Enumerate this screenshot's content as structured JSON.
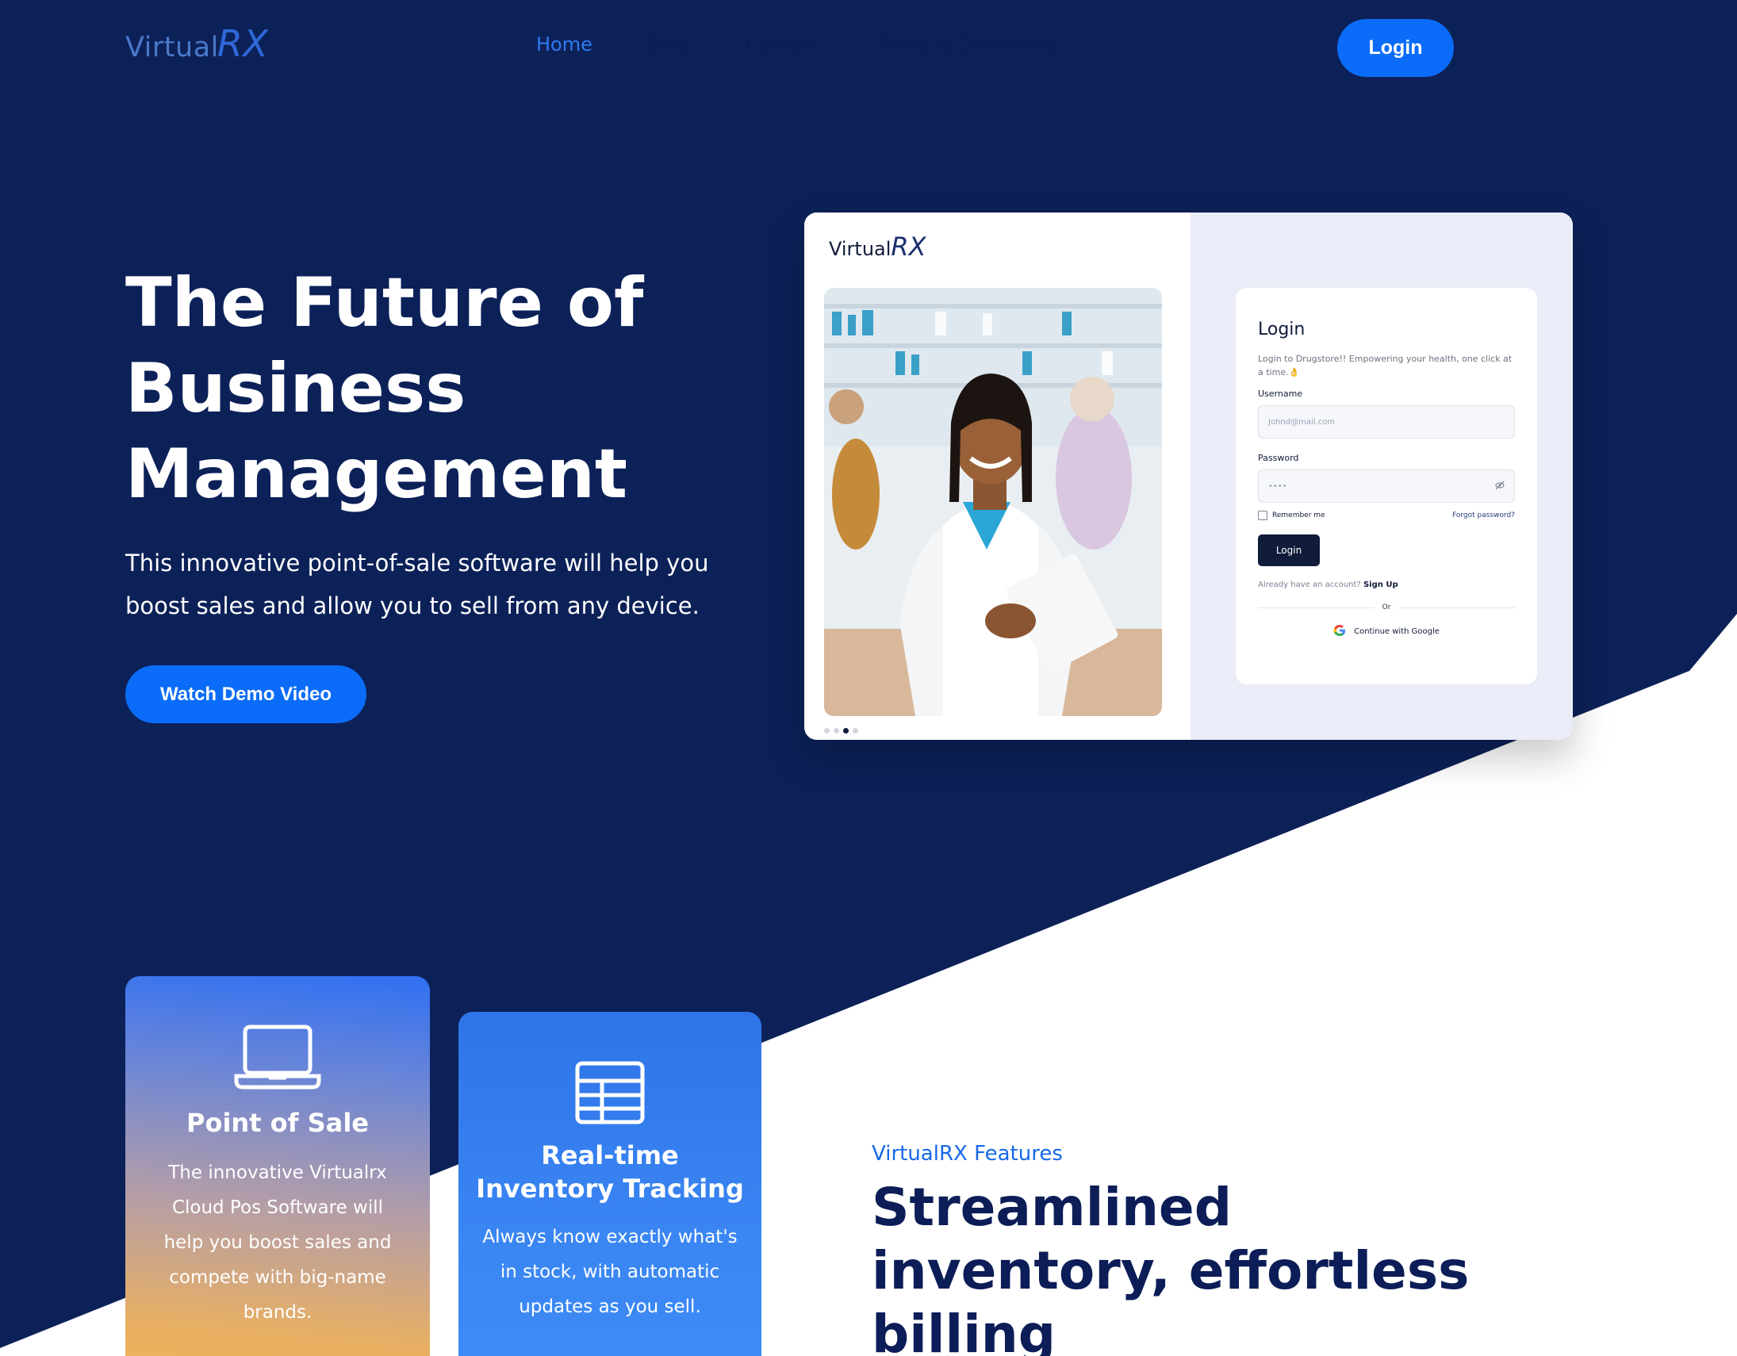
{
  "colors": {
    "navy": "#0c2158",
    "accent_blue": "#0a6cf8",
    "white": "#ffffff"
  },
  "nav": {
    "logo_main": "Virtual",
    "logo_rx": "RX",
    "links": [
      "Home",
      "Blog",
      "Careers",
      "Terms & Conditions"
    ],
    "login": "Login"
  },
  "hero": {
    "title": "The Future of Business Management",
    "subtitle": "This innovative point-of-sale software will help you boost sales and allow you to sell from any device.",
    "cta": "Watch Demo Video"
  },
  "screenshot": {
    "logo_main": "Virtual",
    "logo_rx": "RX",
    "login_title": "Login",
    "login_desc": "Login to Drugstore!! Empowering your health, one click at a time.👌",
    "username_label": "Username",
    "username_placeholder": "Johnd@mail.com",
    "password_label": "Password",
    "password_value": "••••",
    "remember": "Remember me",
    "forgot": "Forgot password?",
    "login_button": "Login",
    "signup_prefix": "Already have an account?",
    "signup_link": "Sign Up",
    "or": "Or",
    "google": "Continue with Google"
  },
  "cards": [
    {
      "icon": "laptop-icon",
      "title": "Point of Sale",
      "text": "The innovative Virtualrx Cloud Pos Software will help you boost sales and compete with big-name brands."
    },
    {
      "icon": "table-icon",
      "title": "Real-time Inventory Tracking",
      "text": "Always know exactly what's in stock, with automatic updates as you sell."
    }
  ],
  "features": {
    "kicker": "VirtualRX Features",
    "title": "Streamlined inventory, effortless billing"
  }
}
